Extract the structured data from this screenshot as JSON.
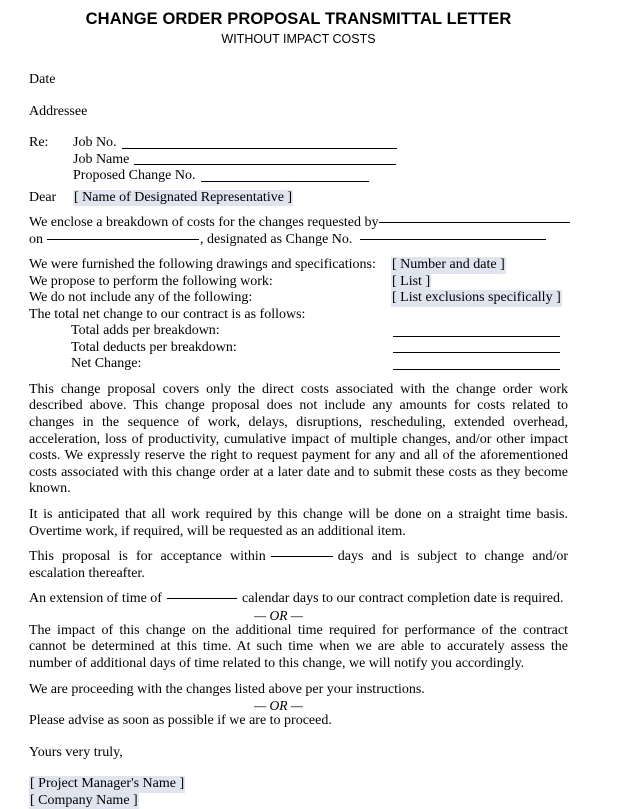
{
  "document": {
    "title": "CHANGE ORDER PROPOSAL TRANSMITTAL LETTER",
    "subtitle": "WITHOUT IMPACT COSTS",
    "date_label": "Date",
    "addressee_label": "Addressee",
    "re": {
      "key": "Re:",
      "rows": [
        {
          "label": "Job No."
        },
        {
          "label": "Job Name"
        },
        {
          "label": "Proposed Change No."
        }
      ]
    },
    "salutation": {
      "key": "Dear",
      "placeholder": "[ Name of Designated Representative ]"
    },
    "enclosure": {
      "line1_text": "We enclose a breakdown of costs for the changes requested by",
      "line2_prefix": "on",
      "line2_middle": ", designated as Change No.",
      "line2_suffix": ""
    },
    "statements": [
      {
        "label": "We were furnished the following drawings and specifications:",
        "value": "[ Number and date ]"
      },
      {
        "label": "We propose to perform the following work:",
        "value": "[ List ]"
      },
      {
        "label": "We do not include any of the following:",
        "value": "[ List exclusions specifically ]"
      }
    ],
    "totals": {
      "intro": "The total net change to our contract is as follows:",
      "rows": [
        {
          "label": "Total adds per breakdown:"
        },
        {
          "label": "Total deducts per breakdown:"
        },
        {
          "label": "Net Change:"
        }
      ]
    },
    "paragraphs": {
      "direct_costs": "This change proposal covers only the direct costs associated with the change order work described above. This change proposal does not include any amounts for costs related to changes in the sequence of work, delays, disruptions, rescheduling, extended overhead, acceleration, loss of productivity, cumulative impact of multiple changes, and/or other impact costs. We expressly reserve the right to request payment for any and all of the aforementioned costs associated with this change order at a later date and to submit these costs as they become known.",
      "straight_time": "It is anticipated that all work required by this change will be done on a straight time basis. Overtime work, if required, will be requested as an additional item.",
      "acceptance_prefix": "This proposal is for acceptance within",
      "acceptance_suffix": "days and is subject to change and/or escalation thereafter.",
      "extension_prefix": "An extension of time of",
      "extension_suffix": "calendar days to our contract completion date is required.",
      "impact_undetermined": "The impact of this change on the additional time required for performance of the contract cannot be determined at this time. At such time when we are able to accurately assess the number of additional days of time related to this change, we will notify you accordingly.",
      "proceeding": "We are proceeding with the changes listed above per your instructions.",
      "please_advise": "Please advise as soon as possible if we are to proceed."
    },
    "or_separator": "— OR —",
    "closing": {
      "valediction": "Yours very truly,",
      "signer_name": "[ Project Manager's Name ]",
      "company_name": "[ Company Name ]"
    },
    "colors": {
      "highlight": "#dfe4ee",
      "text": "#000000",
      "rule": "#000000",
      "page_background": "#ffffff"
    }
  }
}
